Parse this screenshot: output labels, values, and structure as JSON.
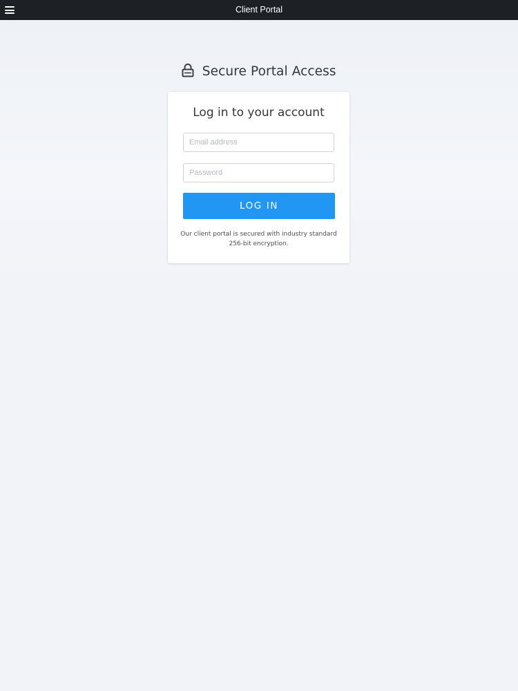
{
  "topbar": {
    "title": "Client Portal",
    "menu_icon": "hamburger-menu-icon"
  },
  "heading": {
    "icon": "lock-icon",
    "text": "Secure Portal Access"
  },
  "login_card": {
    "title": "Log in to your account",
    "email": {
      "value": "",
      "placeholder": "Email address"
    },
    "password": {
      "value": "",
      "placeholder": "Password"
    },
    "submit_label": "LOG IN",
    "security_note": "Our client portal is secured with industry standard 256-bit encryption."
  },
  "colors": {
    "topbar_bg": "#1d2025",
    "page_bg": "#f1f3f8",
    "accent": "#2196f3",
    "card_bg": "#ffffff"
  }
}
